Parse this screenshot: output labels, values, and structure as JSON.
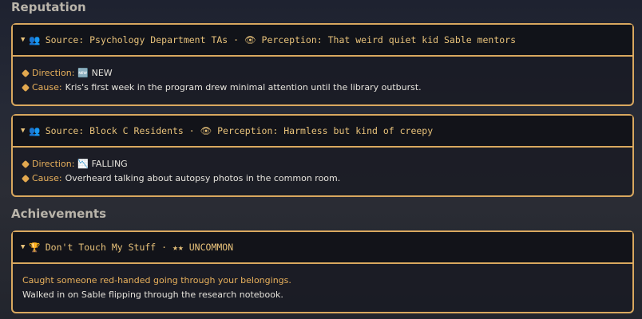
{
  "reputation": {
    "title": "Reputation",
    "cards": [
      {
        "caret": "▼",
        "icon": "👥",
        "header": "Source: Psychology Department TAs · 👁 Perception: That weird quiet kid Sable mentors",
        "direction_label": "Direction:",
        "direction_value": "🆕 NEW",
        "cause_label": "Cause:",
        "cause_value": "Kris's first week in the program drew minimal attention until the library outburst."
      },
      {
        "caret": "▼",
        "icon": "👥",
        "header": "Source: Block C Residents · 👁 Perception: Harmless but kind of creepy",
        "direction_label": "Direction:",
        "direction_value": "📉 FALLING",
        "cause_label": "Cause:",
        "cause_value": "Overheard talking about autopsy photos in the common room."
      }
    ]
  },
  "achievements": {
    "title": "Achievements",
    "cards": [
      {
        "caret": "▼",
        "icon": "🏆",
        "header": "Don't Touch My Stuff · ★★ UNCOMMON",
        "description": "Caught someone red-handed going through your belongings.",
        "detail": "Walked in on Sable flipping through the research notebook."
      }
    ]
  },
  "colors": {
    "accent": "#d9a85f",
    "label": "#e9b15c",
    "text": "#e6e3dc"
  }
}
